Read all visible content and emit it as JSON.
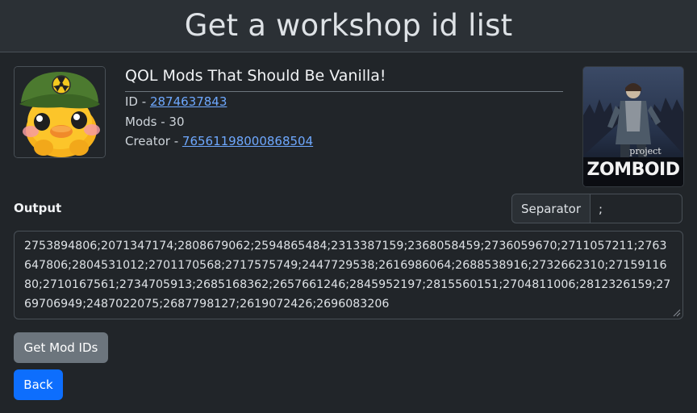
{
  "header": {
    "title": "Get a workshop id list"
  },
  "collection": {
    "title": "QOL Mods That Should Be Vanilla!",
    "id_label": "ID - ",
    "id_value": "2874637843",
    "mods_label": "Mods - 30",
    "creator_label": "Creator - ",
    "creator_value": "76561198000868504"
  },
  "game_image": {
    "small_text": "project",
    "big_text": "ZOMBOID"
  },
  "output": {
    "label": "Output",
    "separator_label": "Separator",
    "separator_value": ";",
    "text": "2753894806;2071347174;2808679062;2594865484;2313387159;2368058459;2736059670;2711057211;2763647806;2804531012;2701170568;2717575749;2447729538;2616986064;2688538916;2732662310;2715911680;2710167561;2734705913;2685168362;2657661246;2845952197;2815560151;2704811006;2812326159;2769706949;2487022075;2687798127;2619072426;2696083206"
  },
  "buttons": {
    "get_mod_ids": "Get Mod IDs",
    "back": "Back"
  },
  "colors": {
    "background": "#212529",
    "header": "#2b3035",
    "link": "#6ea8fe",
    "primary": "#0d6efd",
    "secondary": "#6c757d"
  }
}
